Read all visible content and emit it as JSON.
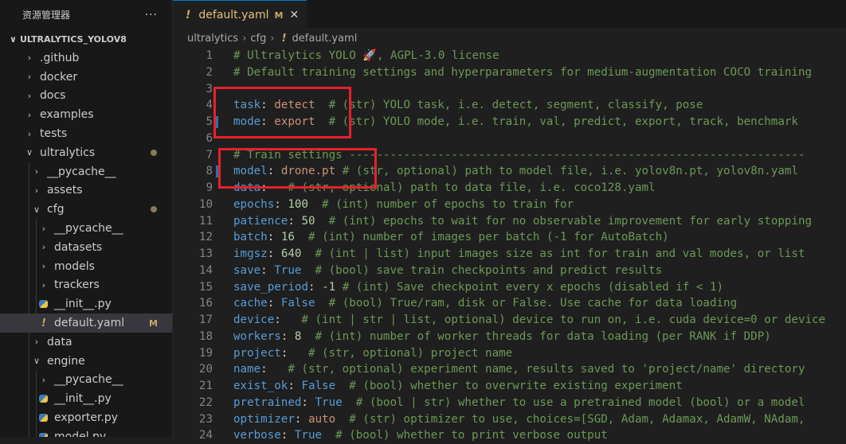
{
  "sidebar": {
    "title": "资源管理器",
    "more": "···",
    "root": "ULTRALYTICS_YOLOV8",
    "items": [
      {
        "label": ".github",
        "type": "folder",
        "open": false,
        "depth": 0
      },
      {
        "label": "docker",
        "type": "folder",
        "open": false,
        "depth": 0
      },
      {
        "label": "docs",
        "type": "folder",
        "open": false,
        "depth": 0
      },
      {
        "label": "examples",
        "type": "folder",
        "open": false,
        "depth": 0
      },
      {
        "label": "tests",
        "type": "folder",
        "open": false,
        "depth": 0
      },
      {
        "label": "ultralytics",
        "type": "folder",
        "open": true,
        "depth": 0,
        "dot": true
      },
      {
        "label": "__pycache__",
        "type": "folder",
        "open": false,
        "depth": 1
      },
      {
        "label": "assets",
        "type": "folder",
        "open": false,
        "depth": 1
      },
      {
        "label": "cfg",
        "type": "folder",
        "open": true,
        "depth": 1,
        "dot": true
      },
      {
        "label": "__pycache__",
        "type": "folder",
        "open": false,
        "depth": 2
      },
      {
        "label": "datasets",
        "type": "folder",
        "open": false,
        "depth": 2
      },
      {
        "label": "models",
        "type": "folder",
        "open": false,
        "depth": 2
      },
      {
        "label": "trackers",
        "type": "folder",
        "open": false,
        "depth": 2
      },
      {
        "label": "__init__.py",
        "type": "py",
        "depth": 2
      },
      {
        "label": "default.yaml",
        "type": "yaml",
        "depth": 2,
        "active": true,
        "badge": "M"
      },
      {
        "label": "data",
        "type": "folder",
        "open": false,
        "depth": 1
      },
      {
        "label": "engine",
        "type": "folder",
        "open": true,
        "depth": 1
      },
      {
        "label": "__pycache__",
        "type": "folder",
        "open": false,
        "depth": 2
      },
      {
        "label": "__init__.py",
        "type": "py",
        "depth": 2
      },
      {
        "label": "exporter.py",
        "type": "py",
        "depth": 2
      },
      {
        "label": "model.py",
        "type": "py",
        "depth": 2
      }
    ]
  },
  "tab": {
    "icon": "!",
    "name": "default.yaml",
    "modified": "M",
    "close": "✕"
  },
  "breadcrumb": {
    "parts": [
      "ultralytics",
      "cfg"
    ],
    "file_icon": "!",
    "file": "default.yaml"
  },
  "lines": [
    {
      "n": "1",
      "comment": "# Ultralytics YOLO 🚀, AGPL-3.0 license"
    },
    {
      "n": "2",
      "comment": "# Default training settings and hyperparameters for medium-augmentation COCO training"
    },
    {
      "n": "3"
    },
    {
      "n": "4",
      "key": "task",
      "value": "detect",
      "vtype": "str",
      "comment": "  # (str) YOLO task, i.e. detect, segment, classify, pose"
    },
    {
      "n": "5",
      "key": "mode",
      "value": "export",
      "vtype": "str",
      "comment": "  # (str) YOLO mode, i.e. train, val, predict, export, track, benchmark",
      "mod": true
    },
    {
      "n": "6"
    },
    {
      "n": "7",
      "comment": "# Train settings -------------------------------------------------------------------"
    },
    {
      "n": "8",
      "key": "model",
      "value": "drone.pt",
      "vtype": "str",
      "comment": " # (str, optional) path to model file, i.e. yolov8n.pt, yolov8n.yaml",
      "mod": true
    },
    {
      "n": "9",
      "key": "data",
      "value": "",
      "vtype": "str",
      "comment": "  # (str, optional) path to data file, i.e. coco128.yaml"
    },
    {
      "n": "10",
      "key": "epochs",
      "value": "100",
      "vtype": "num",
      "comment": "  # (int) number of epochs to train for"
    },
    {
      "n": "11",
      "key": "patience",
      "value": "50",
      "vtype": "num",
      "comment": "  # (int) epochs to wait for no observable improvement for early stopping"
    },
    {
      "n": "12",
      "key": "batch",
      "value": "16",
      "vtype": "num",
      "comment": "  # (int) number of images per batch (-1 for AutoBatch)"
    },
    {
      "n": "13",
      "key": "imgsz",
      "value": "640",
      "vtype": "num",
      "comment": "  # (int | list) input images size as int for train and val modes, or list"
    },
    {
      "n": "14",
      "key": "save",
      "value": "True",
      "vtype": "bool",
      "comment": "  # (bool) save train checkpoints and predict results"
    },
    {
      "n": "15",
      "key": "save_period",
      "value": "-1",
      "vtype": "num",
      "comment": " # (int) Save checkpoint every x epochs (disabled if < 1)"
    },
    {
      "n": "16",
      "key": "cache",
      "value": "False",
      "vtype": "bool",
      "comment": "  # (bool) True/ram, disk or False. Use cache for data loading"
    },
    {
      "n": "17",
      "key": "device",
      "value": "",
      "vtype": "str",
      "comment": "  # (int | str | list, optional) device to run on, i.e. cuda device=0 or device"
    },
    {
      "n": "18",
      "key": "workers",
      "value": "8",
      "vtype": "num",
      "comment": "  # (int) number of worker threads for data loading (per RANK if DDP)"
    },
    {
      "n": "19",
      "key": "project",
      "value": "",
      "vtype": "str",
      "comment": "  # (str, optional) project name"
    },
    {
      "n": "20",
      "key": "name",
      "value": "",
      "vtype": "str",
      "comment": "  # (str, optional) experiment name, results saved to 'project/name' directory"
    },
    {
      "n": "21",
      "key": "exist_ok",
      "value": "False",
      "vtype": "bool",
      "comment": "  # (bool) whether to overwrite existing experiment"
    },
    {
      "n": "22",
      "key": "pretrained",
      "value": "True",
      "vtype": "bool",
      "comment": "  # (bool | str) whether to use a pretrained model (bool) or a model"
    },
    {
      "n": "23",
      "key": "optimizer",
      "value": "auto",
      "vtype": "str",
      "comment": "  # (str) optimizer to use, choices=[SGD, Adam, Adamax, AdamW, NAdam,"
    },
    {
      "n": "24",
      "key": "verbose",
      "value": "True",
      "vtype": "bool",
      "comment": "  # (bool) whether to print verbose output"
    }
  ],
  "colors": {
    "highlight": "#e8202a",
    "accent": "#0078d4"
  }
}
